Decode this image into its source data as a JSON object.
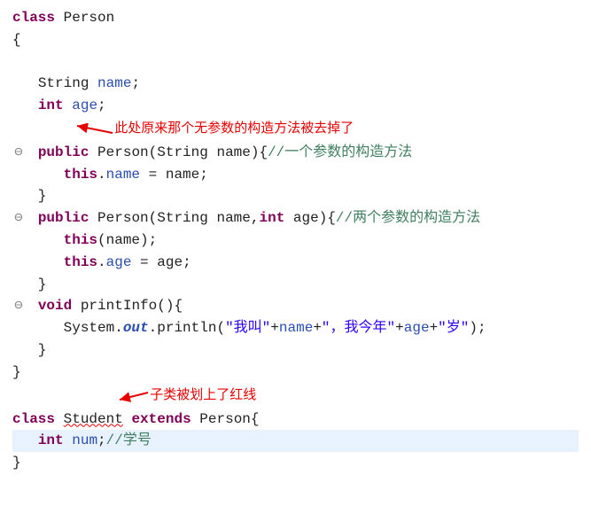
{
  "code": {
    "l1": {
      "kw": "class",
      "name": "Person"
    },
    "l2": "{",
    "l3": {
      "type": "String",
      "name": "name"
    },
    "l4": {
      "kw": "int",
      "name": "age"
    },
    "annotation1": "此处原来那个无参数的构造方法被去掉了",
    "l5": {
      "kw1": "public",
      "name": "Person",
      "p1": "String name",
      "cmt": "//一个参数的构造方法"
    },
    "l6": {
      "kw": "this",
      "field": "name",
      "rhs": "name"
    },
    "l7": "   }",
    "l8": {
      "kw1": "public",
      "name": "Person",
      "p1": "String name",
      "kw2": "int",
      "p2": "age",
      "cmt": "//两个参数的构造方法"
    },
    "l9": {
      "kw": "this",
      "arg": "name"
    },
    "l10": {
      "kw": "this",
      "field": "age",
      "rhs": "age"
    },
    "l11": "   }",
    "l12": {
      "kw": "void",
      "name": "printInfo"
    },
    "l13": {
      "obj": "System",
      "out": "out",
      "m": "println",
      "s1": "\"我叫\"",
      "f1": "name",
      "s2": "\"，我今年\"",
      "f2": "age",
      "s3": "\"岁\""
    },
    "l14": "   }",
    "l15": "}",
    "annotation2": "子类被划上了红线",
    "l16": {
      "kw1": "class",
      "name": "Student",
      "kw2": "extends",
      "sup": "Person"
    },
    "l17": {
      "kw": "int",
      "name": "num",
      "cmt": "//学号"
    },
    "l18": "}"
  },
  "icons": {
    "collapse": "⊖"
  }
}
